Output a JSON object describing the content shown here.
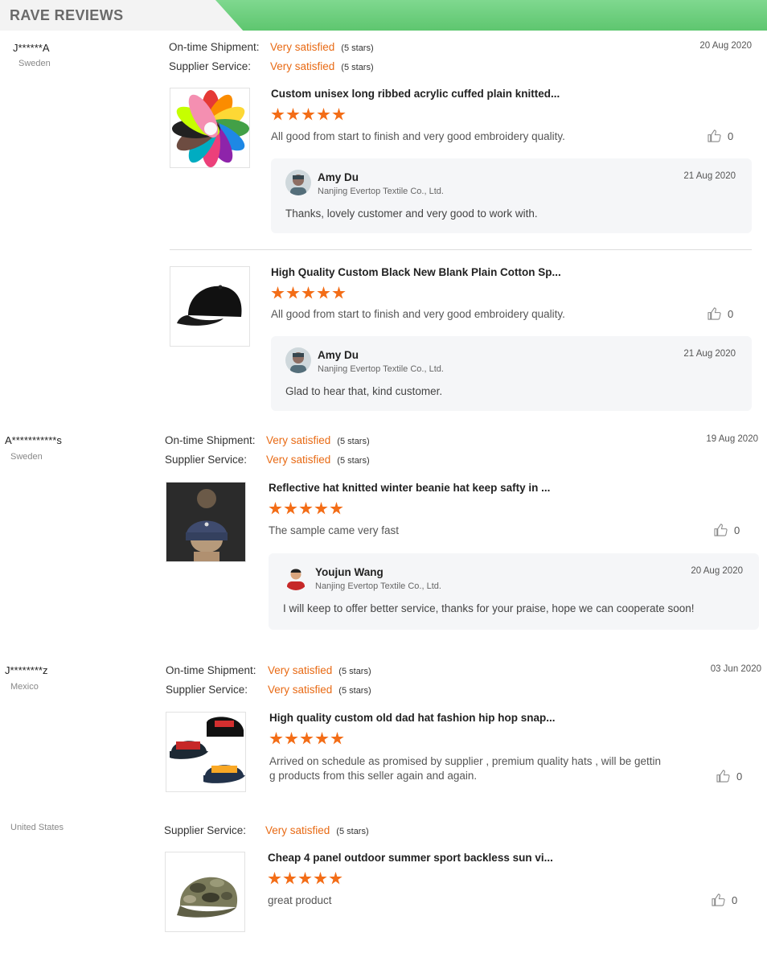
{
  "header": {
    "title": "RAVE REVIEWS"
  },
  "labels": {
    "shipment": "On-time Shipment:",
    "service": "Supplier Service:"
  },
  "reviews": [
    {
      "name": "J******A",
      "country": "Sweden",
      "date": "20 Aug 2020",
      "shipment": {
        "value": "Very satisfied",
        "stars": "(5 stars)"
      },
      "service": {
        "value": "Very satisfied",
        "stars": "(5 stars)"
      },
      "products": [
        {
          "title": "Custom unisex long ribbed acrylic cuffed plain knitted...",
          "rating": 5,
          "comment": "All good from start to finish and very good embroidery quality.",
          "likes": "0",
          "reply": {
            "name": "Amy Du",
            "company": "Nanjing Evertop Textile Co., Ltd.",
            "date": "21 Aug 2020",
            "text": "Thanks, lovely customer and very good to work with."
          }
        },
        {
          "title": "High Quality Custom Black New Blank Plain Cotton Sp...",
          "rating": 5,
          "comment": "All good from start to finish and very good embroidery quality.",
          "likes": "0",
          "reply": {
            "name": "Amy Du",
            "company": "Nanjing Evertop Textile Co., Ltd.",
            "date": "21 Aug 2020",
            "text": "Glad to hear that, kind customer."
          }
        }
      ]
    },
    {
      "name": "A***********s",
      "country": "Sweden",
      "date": "19 Aug 2020",
      "shipment": {
        "value": "Very satisfied",
        "stars": "(5 stars)"
      },
      "service": {
        "value": "Very satisfied",
        "stars": "(5 stars)"
      },
      "products": [
        {
          "title": "Reflective hat knitted winter beanie hat keep safty in ...",
          "rating": 5,
          "comment": "The sample came very fast",
          "likes": "0",
          "reply": {
            "name": "Youjun Wang",
            "company": "Nanjing Evertop Textile Co., Ltd.",
            "date": "20 Aug 2020",
            "text": "I will keep to offer better service, thanks for your praise, hope we can cooperate soon!"
          }
        }
      ]
    },
    {
      "name": "J********z",
      "country": "Mexico",
      "date": "03 Jun 2020",
      "shipment": {
        "value": "Very satisfied",
        "stars": "(5 stars)"
      },
      "service": {
        "value": "Very satisfied",
        "stars": "(5 stars)"
      },
      "products": [
        {
          "title": "High quality custom old dad hat fashion hip hop snap...",
          "rating": 5,
          "comment_line1": "Arrived on schedule as promised by supplier , premium quality hats , will be gettin",
          "comment_line2": "g products from this seller again and again.",
          "likes": "0"
        }
      ]
    },
    {
      "name": "",
      "country": "United States",
      "service": {
        "value": "Very satisfied",
        "stars": "(5 stars)"
      },
      "products": [
        {
          "title": "Cheap 4 panel outdoor summer sport backless sun vi...",
          "rating": 5,
          "comment": "great product",
          "likes": "0"
        }
      ]
    }
  ]
}
